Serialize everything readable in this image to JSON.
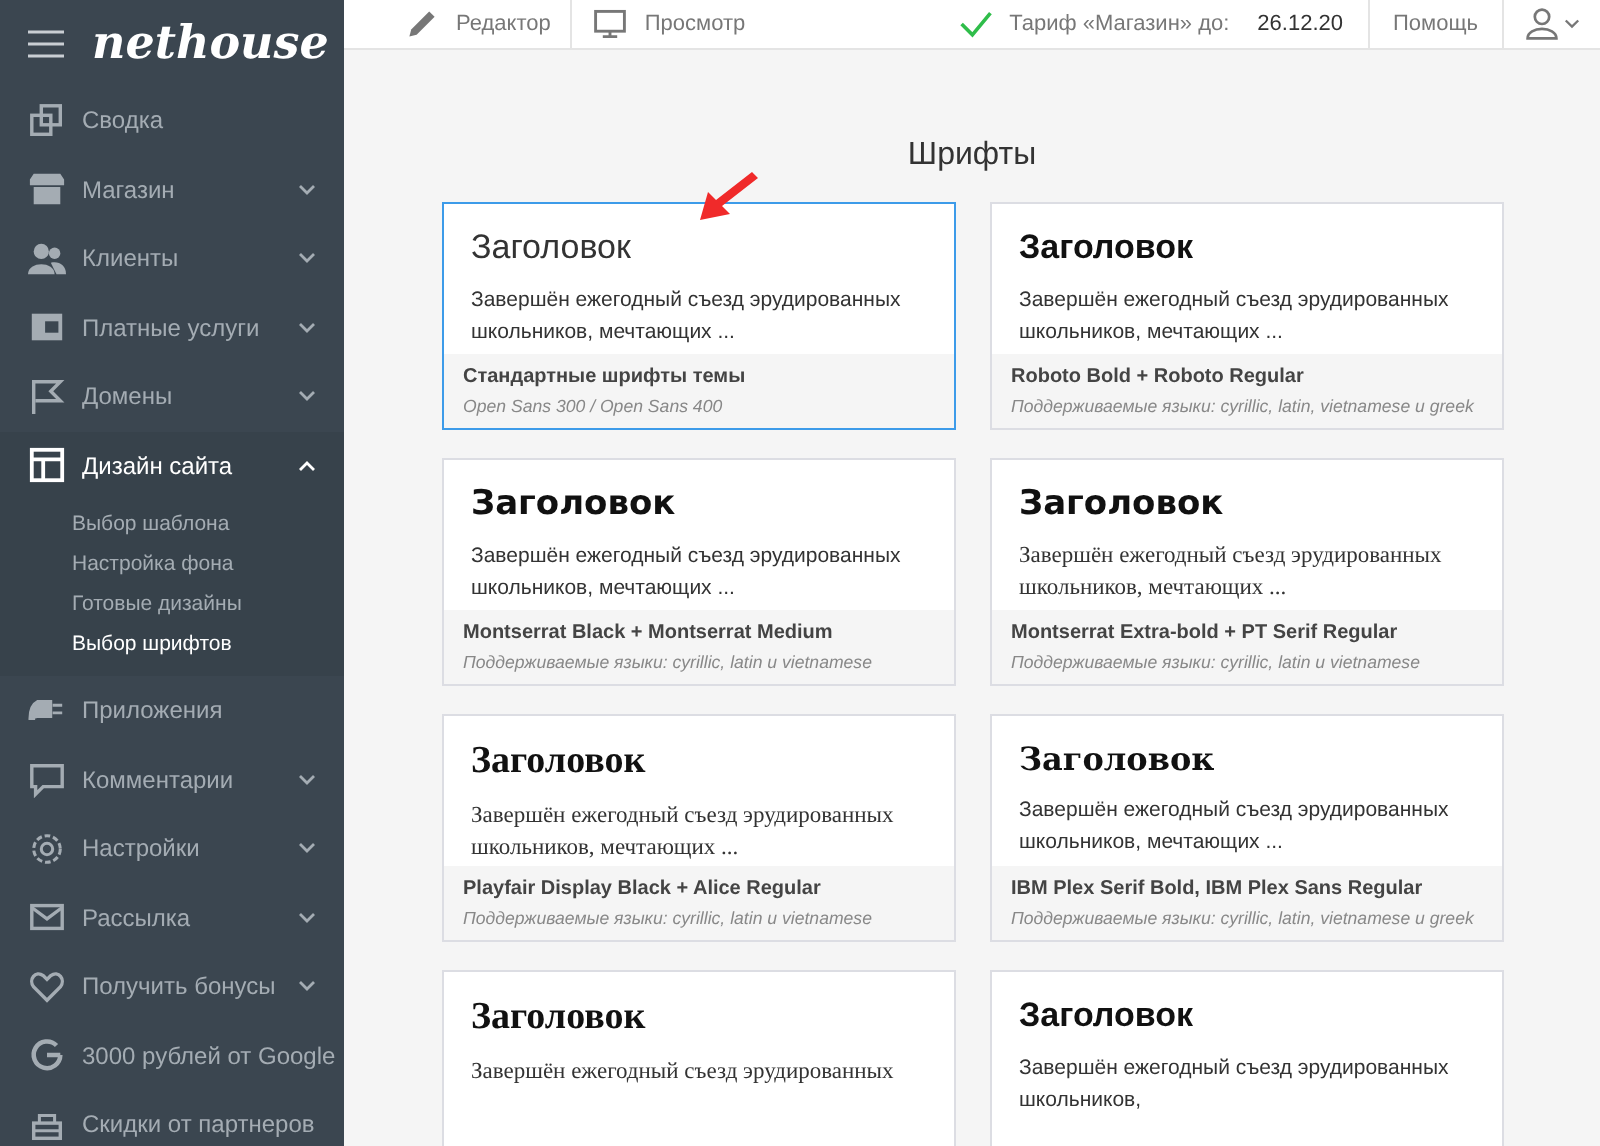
{
  "sidebar": {
    "logo": "nethouse",
    "items": [
      {
        "label": "Сводка",
        "kind": "link",
        "selected": false
      },
      {
        "label": "Магазин",
        "kind": "group",
        "expanded": false,
        "selected": false
      },
      {
        "label": "Клиенты",
        "kind": "group",
        "expanded": false,
        "selected": false
      },
      {
        "label": "Платные услуги",
        "kind": "group",
        "expanded": false,
        "selected": false
      },
      {
        "label": "Домены",
        "kind": "group",
        "expanded": false,
        "selected": false
      },
      {
        "label": "Дизайн сайта",
        "kind": "group",
        "expanded": true,
        "selected": true,
        "children": [
          {
            "label": "Выбор шаблона",
            "selected": false
          },
          {
            "label": "Настройка фона",
            "selected": false
          },
          {
            "label": "Готовые дизайны",
            "selected": false
          },
          {
            "label": "Выбор шрифтов",
            "selected": true
          }
        ]
      },
      {
        "label": "Приложения",
        "kind": "link",
        "selected": false
      },
      {
        "label": "Комментарии",
        "kind": "group",
        "expanded": false,
        "selected": false
      },
      {
        "label": "Настройки",
        "kind": "group",
        "expanded": false,
        "selected": false
      },
      {
        "label": "Рассылка",
        "kind": "group",
        "expanded": false,
        "selected": false
      },
      {
        "label": "Получить бонусы",
        "kind": "group",
        "expanded": false,
        "selected": false
      },
      {
        "label": "3000 рублей от Google",
        "kind": "link",
        "selected": false
      },
      {
        "label": "Скидки от партнеров",
        "kind": "link",
        "selected": false
      }
    ]
  },
  "header": {
    "editor": "Редактор",
    "preview": "Просмотр",
    "tariff_label": "Тариф «Магазин» до:",
    "tariff_date": "26.12.20",
    "help": "Помощь"
  },
  "page_title": "Шрифты",
  "cards": [
    {
      "kind": "light",
      "heading": "Заголовок",
      "text": "Завершён ежегодный съезд эрудированных школьников, мечтающих ...",
      "title": "Стандартные шрифты темы",
      "subtitle": "Open Sans 300 / Open Sans 400",
      "selected": true
    },
    {
      "kind": "sans-bold",
      "heading": "Заголовок",
      "text": "Завершён ежегодный съезд эрудированных школьников, мечтающих ...",
      "title": "Roboto Bold + Roboto Regular",
      "subtitle": "Поддерживаемые языки: cyrillic, latin, vietnamese и greek",
      "selected": false
    },
    {
      "kind": "heavy",
      "heading": "Заголовок",
      "text": "Завершён ежегодный съезд эрудированных школьников, мечтающих ...",
      "title": "Montserrat Black + Montserrat Medium",
      "subtitle": "Поддерживаемые языки: cyrillic, latin и vietnamese",
      "selected": false
    },
    {
      "kind": "heavy-serif",
      "heading": "Заголовок",
      "text": "Завершён ежегодный съезд эрудированных школьников, мечтающих ...",
      "title": "Montserrat Extra-bold + PT Serif Regular",
      "subtitle": "Поддерживаемые языки: cyrillic, latin и vietnamese",
      "selected": false
    },
    {
      "kind": "serif",
      "heading": "Заголовок",
      "text": "Завершён ежегодный съезд эрудированных школьников, мечтающих ...",
      "title": "Playfair Display Black + Alice Regular",
      "subtitle": "Поддерживаемые языки: cyrillic, latin и vietnamese",
      "selected": false
    },
    {
      "kind": "serif-sans",
      "heading": "Заголовок",
      "text": "Завершён ежегодный съезд эрудированных школьников, мечтающих ...",
      "title": "IBM Plex Serif Bold, IBM Plex Sans Regular",
      "subtitle": "Поддерживаемые языки: cyrillic, latin, vietnamese и greek",
      "selected": false
    },
    {
      "kind": "serif",
      "heading": "Заголовок",
      "text": "Завершён ежегодный съезд эрудированных",
      "selected": false
    },
    {
      "kind": "sans-bold",
      "heading": "Заголовок",
      "text": "Завершён ежегодный съезд эрудированных школьников,",
      "selected": false
    }
  ]
}
